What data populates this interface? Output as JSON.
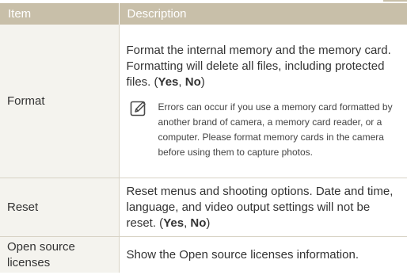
{
  "table": {
    "headers": {
      "item": "Item",
      "description": "Description"
    },
    "rows": [
      {
        "item": "Format",
        "description_main": "Format the internal memory and the memory card. Formatting will delete all files, including protected files. (",
        "option_yes": "Yes",
        "separator": ", ",
        "option_no": "No",
        "closing": ")",
        "note_icon": "note-pencil-icon",
        "note": "Errors can occur if you use a memory card formatted by another brand of camera, a memory card reader, or a computer. Please format memory cards in the camera before using them to capture photos."
      },
      {
        "item": "Reset",
        "description_main": "Reset menus and shooting options. Date and time, language, and video output settings will not be reset. (",
        "option_yes": "Yes",
        "separator": ", ",
        "option_no": "No",
        "closing": ")"
      },
      {
        "item": "Open source licenses",
        "description": "Show the Open source licenses information."
      }
    ]
  },
  "colors": {
    "header_bg": "#c8bfa9",
    "item_col_bg": "#f4f3ee",
    "border": "#d8d3c5",
    "text": "#333333"
  }
}
